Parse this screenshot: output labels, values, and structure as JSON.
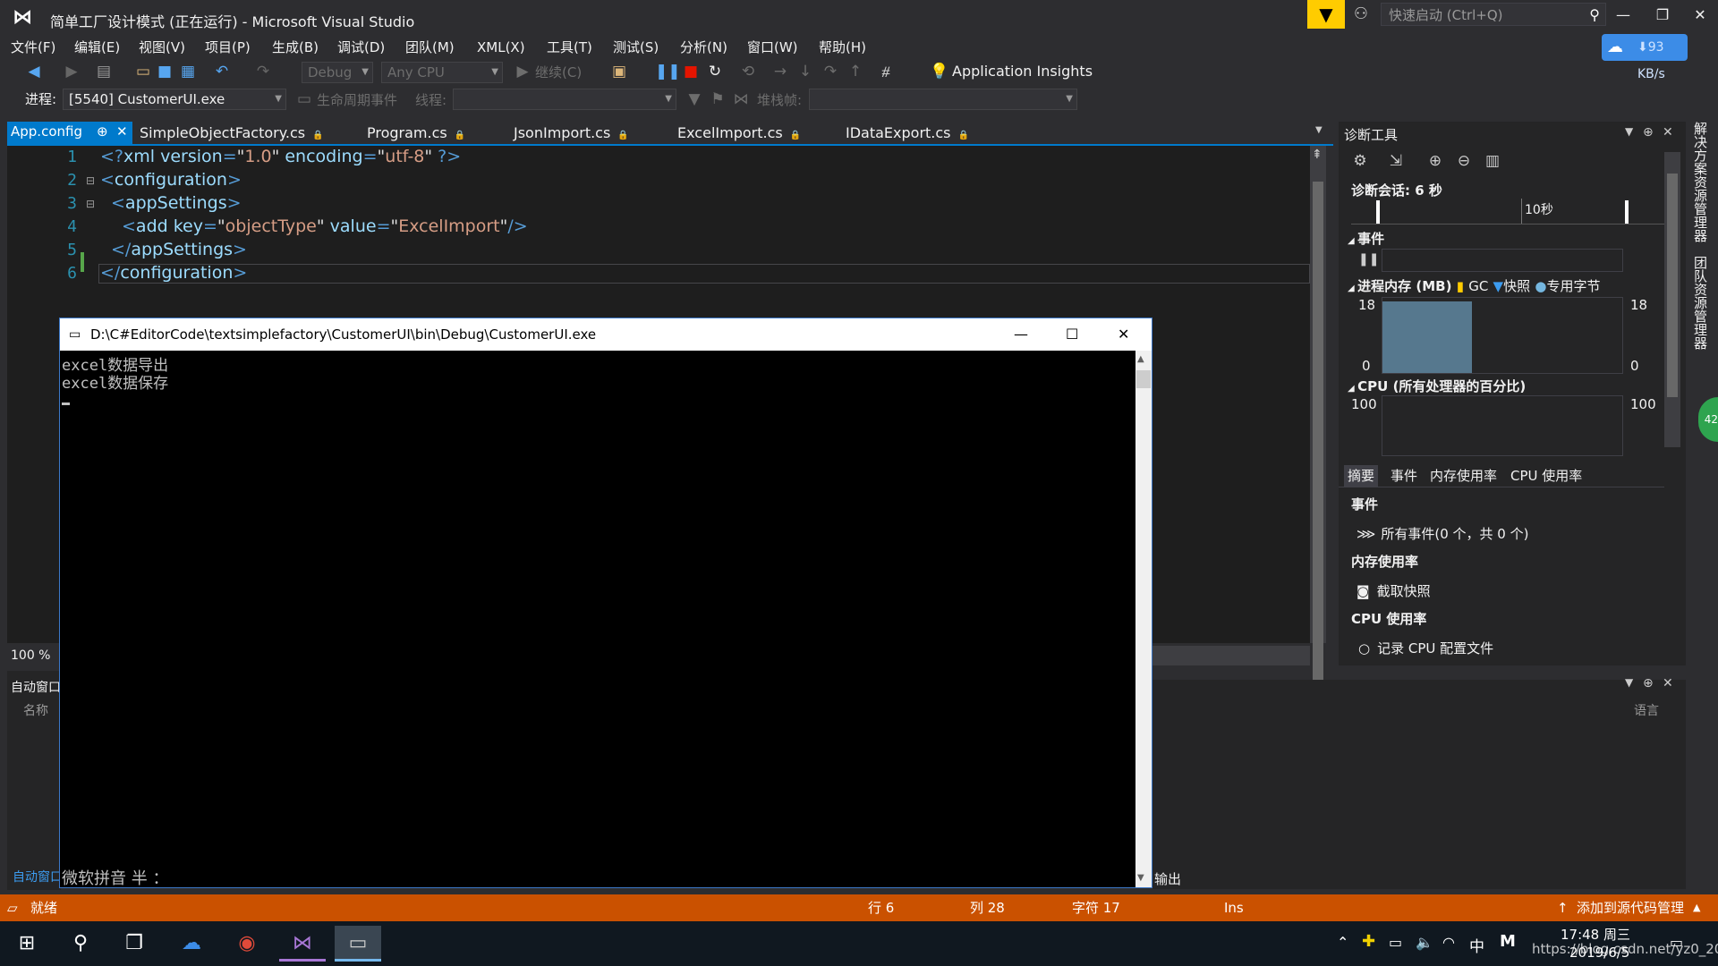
{
  "window": {
    "title": "简单工厂设计模式 (正在运行) - Microsoft Visual Studio",
    "quick_launch_placeholder": "快速启动 (Ctrl+Q)",
    "net_speed": "⬇93 KB/s"
  },
  "menu": [
    "文件(F)",
    "编辑(E)",
    "视图(V)",
    "项目(P)",
    "生成(B)",
    "调试(D)",
    "团队(M)",
    "XML(X)",
    "工具(T)",
    "测试(S)",
    "分析(N)",
    "窗口(W)",
    "帮助(H)"
  ],
  "toolbar": {
    "config": "Debug",
    "platform": "Any CPU",
    "continue_label": "继续(C)",
    "app_insights": "Application Insights",
    "process_label": "进程:",
    "process_value": "[5540] CustomerUI.exe",
    "lifecycle_label": "生命周期事件",
    "thread_label": "线程:",
    "stack_label": "堆栈帧:"
  },
  "tabs": [
    {
      "label": "App.config",
      "pin": "⊕",
      "close": "✕"
    },
    {
      "label": "SimpleObjectFactory.cs",
      "pin": "🔒"
    },
    {
      "label": "Program.cs",
      "pin": "🔒"
    },
    {
      "label": "JsonImport.cs",
      "pin": "🔒"
    },
    {
      "label": "ExcelImport.cs",
      "pin": "🔒"
    },
    {
      "label": "IDataExport.cs",
      "pin": "🔒"
    }
  ],
  "editor": {
    "line_numbers": [
      "1",
      "2",
      "3",
      "4",
      "5",
      "6"
    ],
    "zoom": "100 %",
    "autos_title": "自动窗口",
    "autos_col": "名称",
    "autos_tab": "自动窗口"
  },
  "console": {
    "title": "D:\\C#EditorCode\\textsimplefactory\\CustomerUI\\bin\\Debug\\CustomerUI.exe",
    "lines": [
      "excel数据导出",
      "excel数据保存"
    ],
    "ime": "微软拼音 半 ："
  },
  "diag": {
    "title": "诊断工具",
    "session": "诊断会话: 6 秒",
    "timeline_label": "10秒",
    "events_header": "事件",
    "memory_header": "进程内存 (MB)",
    "legend_gc": "GC",
    "legend_snapshot": "快照",
    "legend_private": "专用字节",
    "mem_max": "18",
    "mem_min": "0",
    "cpu_header": "CPU (所有处理器的百分比)",
    "cpu_max": "100",
    "tabs": [
      "摘要",
      "事件",
      "内存使用率",
      "CPU 使用率"
    ],
    "section_events": "事件",
    "all_events": "所有事件(0 个，共 0 个)",
    "section_memory": "内存使用率",
    "snapshot": "截取快照",
    "section_cpu": "CPU 使用率",
    "record_cpu": "记录 CPU 配置文件"
  },
  "right_rail": [
    "解决方案资源管理器",
    "团队资源管理器"
  ],
  "output": {
    "lang_col": "语言",
    "tab": "输出"
  },
  "status": {
    "ready": "就绪",
    "line": "行 6",
    "col": "列 28",
    "char": "字符 17",
    "ins": "Ins",
    "source_control": "添加到源代码管理"
  },
  "taskbar": {
    "time": "17:48 周三",
    "date": "2019/6/5",
    "ime": "中",
    "watermark": "https://blog.csdn.net/yz0_20"
  },
  "colors": {
    "accent": "#007acc",
    "status_bar": "#ca5100",
    "editor_bg": "#1e1e1e"
  }
}
